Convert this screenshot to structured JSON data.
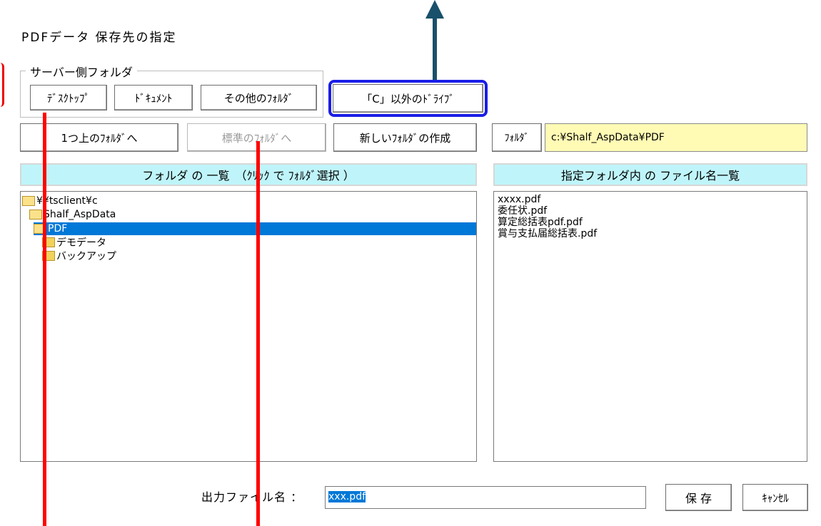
{
  "window": {
    "title": "PDFデータ 保存先の指定"
  },
  "server_group": {
    "legend": "サーバー側フォルダ"
  },
  "buttons": {
    "desktop": "ﾃﾞｽｸﾄｯﾌﾟ",
    "documents": "ﾄﾞｷｭﾒﾝﾄ",
    "other_folder": "その他のﾌｫﾙﾀﾞ",
    "non_c_drive": "「C」以外のﾄﾞﾗｲﾌﾞ",
    "up_folder": "1つ上のﾌｫﾙﾀﾞへ",
    "default_folder": "標準のﾌｫﾙﾀﾞへ",
    "new_folder": "新しいﾌｫﾙﾀﾞの作成",
    "save": "保 存",
    "cancel": "ｷｬﾝｾﾙ"
  },
  "folder": {
    "label": "ﾌｫﾙﾀﾞ",
    "path": "c:¥Shalf_AspData¥PDF"
  },
  "folder_list": {
    "header": "フォルダ の 一覧　（ｸﾘｯｸ で ﾌｫﾙﾀﾞ選択 ）",
    "items": [
      "¥¥tsclient¥c",
      "Shalf_AspData",
      "PDF",
      "デモデータ",
      "バックアップ"
    ],
    "selected": "PDF"
  },
  "file_list": {
    "header": "指定フォルダ内 の ファイル名一覧",
    "items": [
      "xxxx.pdf",
      "委任状.pdf",
      "算定総括表pdf.pdf",
      "賞与支払届総括表.pdf"
    ]
  },
  "output": {
    "label": "出力ファイル名 ：",
    "value": "xxx.pdf"
  },
  "colors": {
    "highlight_border": "#1a1ee6",
    "arrow": "#19506b",
    "annotation_line": "#ff0000",
    "list_header_bg": "#bff5fa",
    "path_bg": "#fffbb5",
    "selection": "#0078d7"
  }
}
